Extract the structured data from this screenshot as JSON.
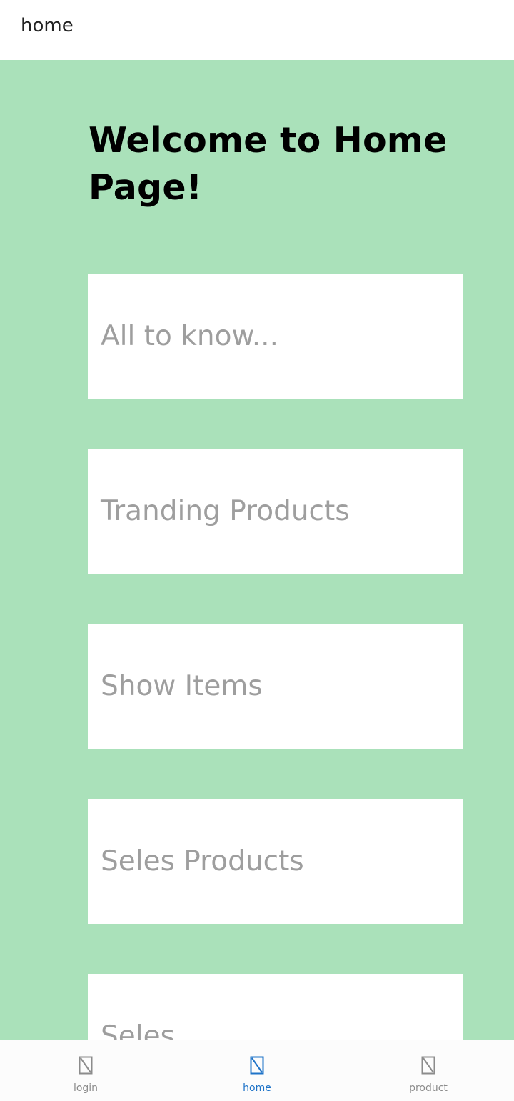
{
  "header": {
    "title": "home"
  },
  "main": {
    "welcome": "Welcome to Home Page!",
    "cards": [
      {
        "label": "All to know..."
      },
      {
        "label": "Tranding Products"
      },
      {
        "label": "Show Items"
      },
      {
        "label": "Seles Products"
      },
      {
        "label": "Seles"
      }
    ],
    "background_color": "#aae1ba"
  },
  "bottom_nav": {
    "items": [
      {
        "label": "login",
        "icon": "missing-glyph-icon",
        "active": false
      },
      {
        "label": "home",
        "icon": "missing-glyph-icon",
        "active": true
      },
      {
        "label": "product",
        "icon": "missing-glyph-icon",
        "active": false
      }
    ],
    "active_color": "#1e73c8",
    "inactive_color": "#8c8c8c"
  }
}
